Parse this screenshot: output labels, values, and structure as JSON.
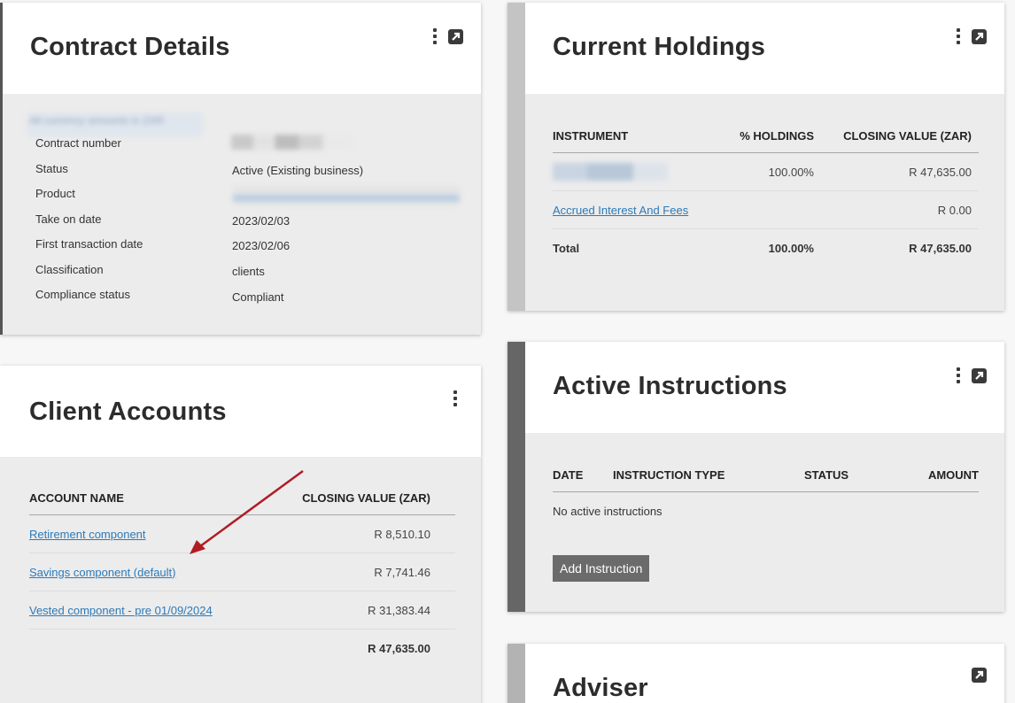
{
  "contract": {
    "title": "Contract Details",
    "header_note": "All currency amounts in ZAR",
    "fields": [
      {
        "label": "Contract number",
        "value": ""
      },
      {
        "label": "Status",
        "value": "Active (Existing business)"
      },
      {
        "label": "Product",
        "value": ""
      },
      {
        "label": "Take on date",
        "value": "2023/02/03"
      },
      {
        "label": "First transaction date",
        "value": "2023/02/06"
      },
      {
        "label": "Classification",
        "value": "clients"
      },
      {
        "label": "Compliance status",
        "value": "Compliant"
      }
    ]
  },
  "holdings": {
    "title": "Current Holdings",
    "columns": [
      "INSTRUMENT",
      "% HOLDINGS",
      "CLOSING VALUE (ZAR)"
    ],
    "rows": [
      {
        "instrument": "",
        "pct": "100.00%",
        "value": "R 47,635.00"
      },
      {
        "instrument": "Accrued Interest And Fees",
        "pct": "",
        "value": "R 0.00"
      }
    ],
    "total": {
      "label": "Total",
      "pct": "100.00%",
      "value": "R 47,635.00"
    }
  },
  "accounts": {
    "title": "Client Accounts",
    "columns": [
      "ACCOUNT NAME",
      "CLOSING VALUE (ZAR)"
    ],
    "rows": [
      {
        "name": "Retirement component",
        "value": "R 8,510.10"
      },
      {
        "name": "Savings component (default)",
        "value": "R 7,741.46"
      },
      {
        "name": "Vested component - pre 01/09/2024",
        "value": "R 31,383.44"
      }
    ],
    "total": "R 47,635.00"
  },
  "instructions": {
    "title": "Active Instructions",
    "columns": [
      "DATE",
      "INSTRUCTION TYPE",
      "STATUS",
      "AMOUNT"
    ],
    "empty_text": "No active instructions",
    "add_button": "Add Instruction"
  },
  "adviser": {
    "title": "Adviser"
  },
  "icons": {
    "menu": "vertical-dots-icon",
    "expand": "expand-arrow-icon"
  },
  "colors": {
    "link": "#2d7ab8",
    "annotation_arrow": "#b01c24",
    "accent_light": "#c4c4c4",
    "accent_dark": "#666666"
  }
}
